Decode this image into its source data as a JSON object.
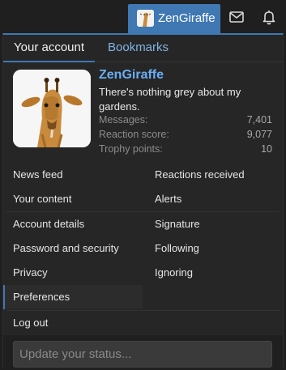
{
  "header": {
    "username": "ZenGiraffe",
    "icons": [
      "mail-icon",
      "bell-icon"
    ]
  },
  "tabs": [
    {
      "label": "Your account",
      "active": true
    },
    {
      "label": "Bookmarks",
      "active": false
    }
  ],
  "profile": {
    "username": "ZenGiraffe",
    "status": "There's nothing grey about my gardens.",
    "stats": [
      {
        "label": "Messages:",
        "value": "7,401"
      },
      {
        "label": "Reaction score:",
        "value": "9,077"
      },
      {
        "label": "Trophy points:",
        "value": "10"
      }
    ]
  },
  "menu": {
    "left": [
      "News feed",
      "Your content",
      "Account details",
      "Password and security",
      "Privacy",
      "Preferences",
      "Log out"
    ],
    "right": [
      "Reactions received",
      "Alerts",
      "Signature",
      "Following",
      "Ignoring"
    ],
    "active": "Preferences"
  },
  "status_input": {
    "placeholder": "Update your status..."
  },
  "colors": {
    "accent": "#3f78b2",
    "link": "#6aaef5",
    "panel": "#262626",
    "background": "#1f1f1f"
  }
}
